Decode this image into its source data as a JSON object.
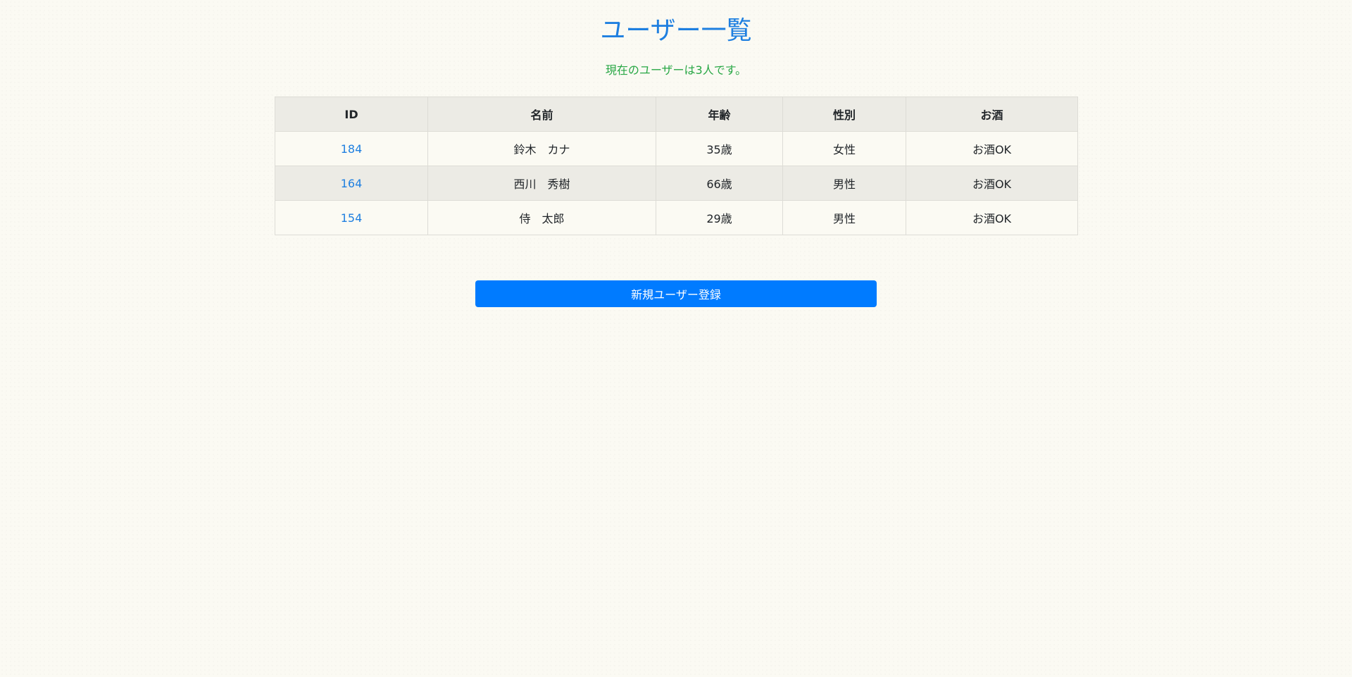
{
  "page": {
    "title": "ユーザー一覧",
    "subtitle": "現在のユーザーは3人です。"
  },
  "table": {
    "headers": [
      "ID",
      "名前",
      "年齢",
      "性別",
      "お酒"
    ],
    "rows": [
      {
        "id": "184",
        "name": "鈴木　カナ",
        "age": "35歳",
        "gender": "女性",
        "alcohol": "お酒OK"
      },
      {
        "id": "164",
        "name": "西川　秀樹",
        "age": "66歳",
        "gender": "男性",
        "alcohol": "お酒OK"
      },
      {
        "id": "154",
        "name": "侍　太郎",
        "age": "29歳",
        "gender": "男性",
        "alcohol": "お酒OK"
      }
    ]
  },
  "actions": {
    "register_label": "新規ユーザー登録"
  },
  "colors": {
    "accent": "#007bff",
    "title": "#1e7fe0",
    "subtitle": "#28a745"
  }
}
